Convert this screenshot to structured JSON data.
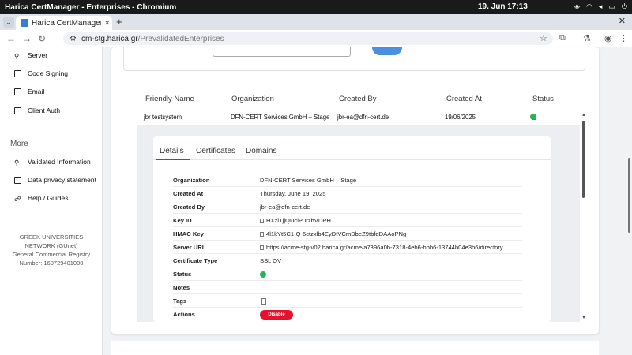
{
  "os": {
    "window_title": "Harica CertManager - Enterprises - Chromium",
    "datetime": "19. Jun  17:13"
  },
  "browser": {
    "tab_title": "Harica CertManager - E",
    "tab_close": "✕",
    "new_tab": "+",
    "url_host": "cm-stg.harica.gr",
    "url_path": "/PrevalidatedEnterprises"
  },
  "sidebar": {
    "items_top": [
      {
        "label": "Server",
        "icon": "server-icon"
      },
      {
        "label": "Code Signing",
        "icon": "code-signing-icon"
      },
      {
        "label": "Email",
        "icon": "email-icon"
      },
      {
        "label": "Client Auth",
        "icon": "client-auth-icon"
      }
    ],
    "section_more": "More",
    "items_more": [
      {
        "label": "Validated Information",
        "icon": "validated-info-icon"
      },
      {
        "label": "Data privacy statement",
        "icon": "data-privacy-icon"
      },
      {
        "label": "Help / Guides",
        "icon": "help-icon"
      }
    ],
    "footer": [
      "GREEK UNIVERSITIES",
      "NETWORK (GUnet)",
      "General Commercial Registry",
      "Number: 160729401000"
    ]
  },
  "table": {
    "headers": [
      "Friendly Name",
      "Organization",
      "Created By",
      "Created At",
      "Status"
    ],
    "row": {
      "friendly_name": "jbr testsystem",
      "organization": "DFN-CERT Services GmbH – Stage",
      "created_by": "jbr-ea@dfn-cert.de",
      "created_at": "19/06/2025"
    }
  },
  "details": {
    "tabs": [
      "Details",
      "Certificates",
      "Domains"
    ],
    "active_tab": "Details",
    "rows": [
      {
        "key": "Organization",
        "value": "DFN-CERT Services GmbH – Stage"
      },
      {
        "key": "Created At",
        "value": "Thursday, June 19, 2025"
      },
      {
        "key": "Created By",
        "value": "jbr-ea@dfn-cert.de"
      },
      {
        "key": "Key ID",
        "value": "HXzlTjjQUclP0rzbVDPH",
        "copy": true
      },
      {
        "key": "HMAC Key",
        "value": "4l1kYt5C1-Q-6ctzxlb4EyDtVCmDbeZ9tbfdDAAoPNg",
        "copy": true
      },
      {
        "key": "Server URL",
        "value": "https://acme-stg-v02.harica.gr/acme/a7396a0b-7318-4eb6-bbb6-13744b04e3b6/directory",
        "copy": true
      },
      {
        "key": "Certificate Type",
        "value": "SSL OV"
      },
      {
        "key": "Status",
        "value": ""
      },
      {
        "key": "Notes",
        "value": ""
      },
      {
        "key": "Tags",
        "value": ""
      },
      {
        "key": "Actions",
        "value": ""
      }
    ],
    "disable_label": "Disable"
  },
  "colors": {
    "accent_blue": "#4a90e2",
    "status_green": "#27b45a",
    "danger_red": "#e8102f"
  }
}
